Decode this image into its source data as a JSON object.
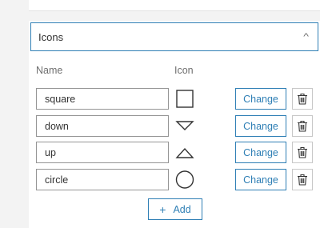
{
  "section": {
    "title": "Icons",
    "caret": "^"
  },
  "columns": {
    "name": "Name",
    "icon": "Icon"
  },
  "rows": [
    {
      "name": "square",
      "icon": "square-icon",
      "change_label": "Change"
    },
    {
      "name": "down",
      "icon": "triangle-down-icon",
      "change_label": "Change"
    },
    {
      "name": "up",
      "icon": "triangle-up-icon",
      "change_label": "Change"
    },
    {
      "name": "circle",
      "icon": "circle-icon",
      "change_label": "Change"
    }
  ],
  "add_button": {
    "icon": "+",
    "label": "Add"
  },
  "colors": {
    "accent": "#2f7fb5",
    "border": "#959595",
    "background": "#f3f3f3"
  }
}
